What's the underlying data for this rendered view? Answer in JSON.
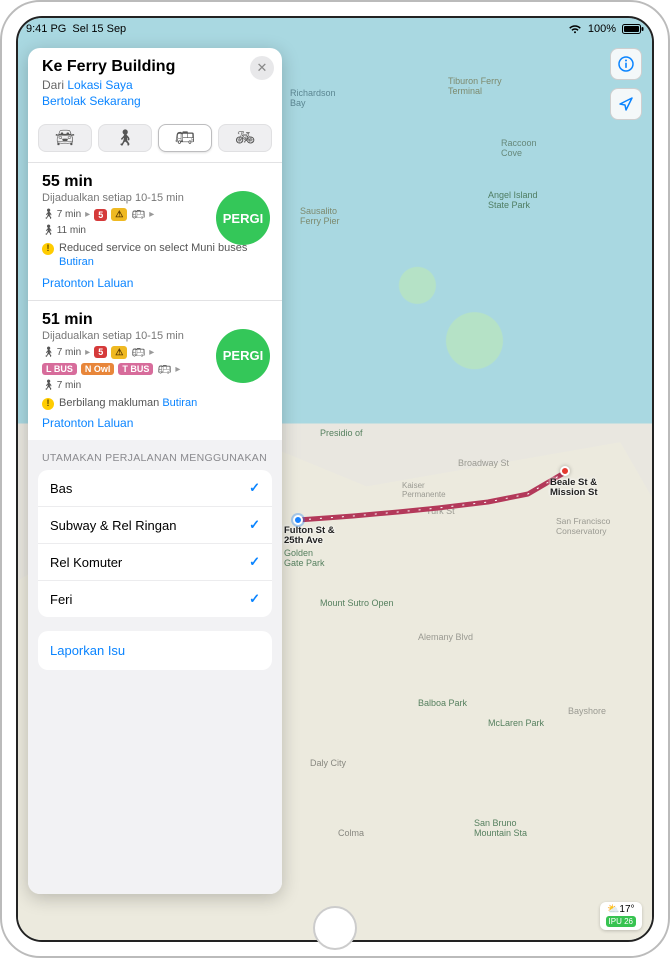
{
  "status": {
    "time": "9:41 PG",
    "date": "Sel 15 Sep",
    "battery": "100%"
  },
  "top_controls": {
    "info_name": "info-button",
    "locate_name": "locate-button"
  },
  "card": {
    "title": "Ke Ferry Building",
    "from_prefix": "Dari ",
    "from_link": "Lokasi Saya",
    "depart": "Bertolak Sekarang",
    "modes": {
      "car": "car",
      "walk": "walk",
      "transit": "transit",
      "bike": "bike",
      "selected": "transit"
    }
  },
  "routes": [
    {
      "duration": "55 min",
      "frequency": "Dijadualkan setiap 10-15 min",
      "walk1": "7 min",
      "line1": "5",
      "walk2": "11 min",
      "alert_text": "Reduced service on select Muni buses ",
      "alert_link": "Butiran",
      "preview": "Pratonton Laluan",
      "go": "PERGI"
    },
    {
      "duration": "51 min",
      "frequency": "Dijadualkan setiap 10-15 min",
      "walk1": "7 min",
      "line1": "5",
      "badges": [
        "L BUS",
        "N Owl",
        "T BUS"
      ],
      "walk2": "7 min",
      "alert_text": "Berbilang makluman ",
      "alert_link": "Butiran",
      "preview": "Pratonton Laluan",
      "go": "PERGI"
    }
  ],
  "prefs": {
    "title": "UTAMAKAN PERJALANAN MENGGUNAKAN",
    "items": [
      {
        "label": "Bas",
        "checked": true
      },
      {
        "label": "Subway & Rel Ringan",
        "checked": true
      },
      {
        "label": "Rel Komuter",
        "checked": true
      },
      {
        "label": "Feri",
        "checked": true
      }
    ],
    "report": "Laporkan Isu"
  },
  "map_labels": {
    "richardson": "Richardson\nBay",
    "tiburon": "Tiburon Ferry\nTerminal",
    "raccoon": "Raccoon\nCove",
    "angel": "Angel Island\nState Park",
    "sausalito": "Sausalito\nFerry Pier",
    "broadway": "Broadway St",
    "turk": "Turk St",
    "alemany": "Alemany Blvd",
    "sfconserv": "San Francisco\nConservatory",
    "presidio": "Presidio of",
    "ggpark": "Golden\nGate Park",
    "mtsutro": "Mount Sutro Open",
    "balboa": "Balboa Park",
    "mclaren": "McLaren Park",
    "bayshore": "Bayshore",
    "dalycity": "Daly City",
    "colma": "Colma",
    "sanbruno": "San Bruno\nMountain Sta",
    "kaiser": "Kaiser\nPermanente",
    "start": "Fulton St &\n25th Ave",
    "end": "Beale St &\nMission St"
  },
  "weather": {
    "temp": "17°",
    "ipu": "IPU 26"
  }
}
